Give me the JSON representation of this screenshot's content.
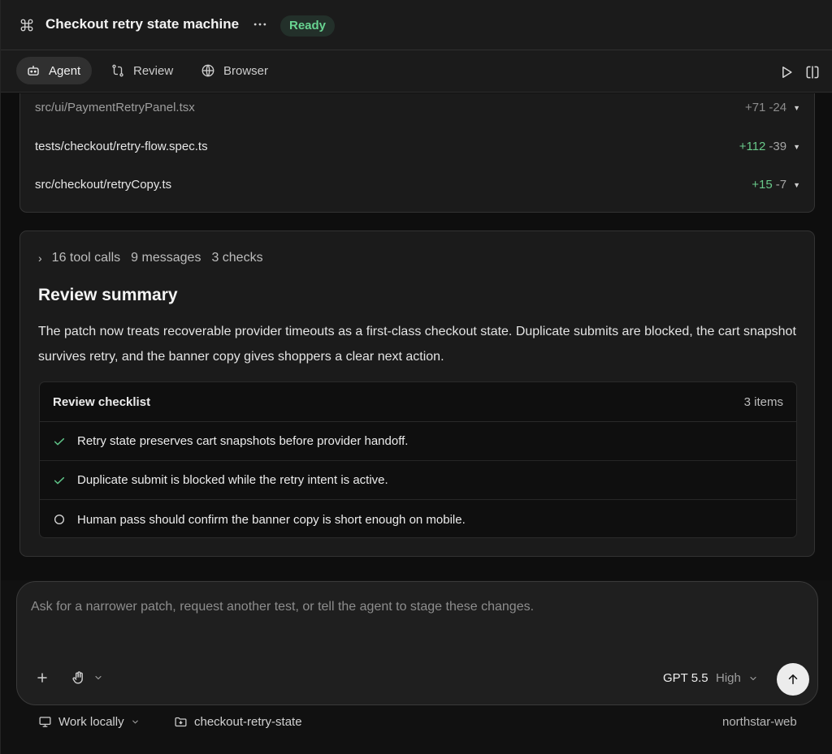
{
  "header": {
    "title": "Checkout retry state machine",
    "status": "Ready",
    "status_color": "#68d391",
    "icons": [
      "command-icon",
      "more-icon"
    ]
  },
  "tabs": [
    {
      "label": "Agent",
      "icon": "robot-icon",
      "active": true
    },
    {
      "label": "Review",
      "icon": "git-compare-icon",
      "active": false
    },
    {
      "label": "Browser",
      "icon": "globe-icon",
      "active": false
    }
  ],
  "changed_files": [
    {
      "path": "src/ui/PaymentRetryPanel.tsx",
      "added": "+71",
      "removed": "-24"
    },
    {
      "path": "tests/checkout/retry-flow.spec.ts",
      "added": "+112",
      "removed": "-39"
    },
    {
      "path": "src/checkout/retryCopy.ts",
      "added": "+15",
      "removed": "-7"
    }
  ],
  "summary": {
    "tool_calls": "16 tool calls",
    "messages": "9 messages",
    "checks": "3 checks",
    "title": "Review summary",
    "body": "The patch now treats recoverable provider timeouts as a first-class checkout state. Duplicate submits are blocked, the cart snapshot survives retry, and the banner copy gives shoppers a clear next action."
  },
  "checklist": {
    "label": "Review checklist",
    "count": "3 items",
    "items": [
      {
        "text": "Retry state preserves cart snapshots before provider handoff.",
        "done": true
      },
      {
        "text": "Duplicate submit is blocked while the retry intent is active.",
        "done": true
      },
      {
        "text": "Human pass should confirm the banner copy is short enough on mobile.",
        "done": false
      }
    ]
  },
  "composer": {
    "placeholder": "Ask for a narrower patch, request another test, or tell the agent to stage these changes.",
    "value": "",
    "model": "GPT 5.5",
    "effort": "High"
  },
  "footer": {
    "location": "Work locally",
    "branch": "checkout-retry-state",
    "repo": "northstar-web"
  }
}
